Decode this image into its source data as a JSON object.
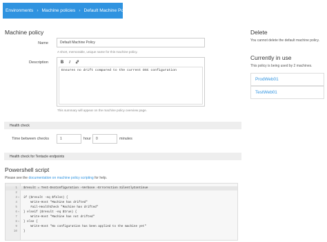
{
  "breadcrumb": [
    {
      "label": "Environments"
    },
    {
      "label": "Machine policies"
    },
    {
      "label": "Default Machine Policy"
    }
  ],
  "breadcrumb_separator": "›",
  "form": {
    "section_title": "Machine policy",
    "name_label": "Name",
    "name_value": "Default Machine Policy",
    "name_hint": "A short, memorable, unique name for this machine policy.",
    "description_label": "Description",
    "description_value": "Ensures no drift compared to the current DSC configuration",
    "description_hint": "This summary will appear on the machine policy overview page.",
    "toolbar": {
      "bold": "B",
      "italic": "I",
      "link_icon": "link-icon"
    }
  },
  "health_check": {
    "bar_label": "Health check",
    "time_label": "Time between checks",
    "hours_value": "1",
    "hours_unit": "hour",
    "minutes_value": "0",
    "minutes_unit": "minutes",
    "tentacle_bar_label": "Health check for Tentacle endpoints"
  },
  "powershell": {
    "title": "Powershell script",
    "intro_text": "Please see the",
    "link_text": "documentation on machine policy scripting",
    "intro_suffix": "for help.",
    "lines": [
      {
        "n": "1",
        "fold": "",
        "code": "$result = Test-DscConfiguration -Verbose -ErrorAction SilentlyContinue"
      },
      {
        "n": "2",
        "fold": "",
        "code": ""
      },
      {
        "n": "3",
        "fold": "▾",
        "code": "if ($result -eq $false) {"
      },
      {
        "n": "4",
        "fold": "",
        "code": "    Write-Host \"Machine has drifted\""
      },
      {
        "n": "5",
        "fold": "",
        "code": "    Fail-HealthCheck \"Machine has drifted\""
      },
      {
        "n": "6",
        "fold": "▾",
        "code": "} elseif ($result -eq $true) {"
      },
      {
        "n": "7",
        "fold": "",
        "code": "    Write-Host \"Machine has not drifted\""
      },
      {
        "n": "8",
        "fold": "▾",
        "code": "} else {"
      },
      {
        "n": "9",
        "fold": "",
        "code": "    Write-Host \"No configuration has been applied to the machine yet\""
      },
      {
        "n": "10",
        "fold": "",
        "code": "}"
      }
    ]
  },
  "sidebar": {
    "delete_title": "Delete",
    "delete_text": "You cannot delete the default machine policy.",
    "in_use_title": "Currently in use",
    "in_use_text": "This policy is being used by 2 machines.",
    "machines": [
      {
        "label": "ProdWeb01"
      },
      {
        "label": "TestWeb01"
      }
    ]
  },
  "colors": {
    "accent": "#2f93e0",
    "section_bar": "#eeeeee",
    "code_background": "#f7f7f7"
  }
}
